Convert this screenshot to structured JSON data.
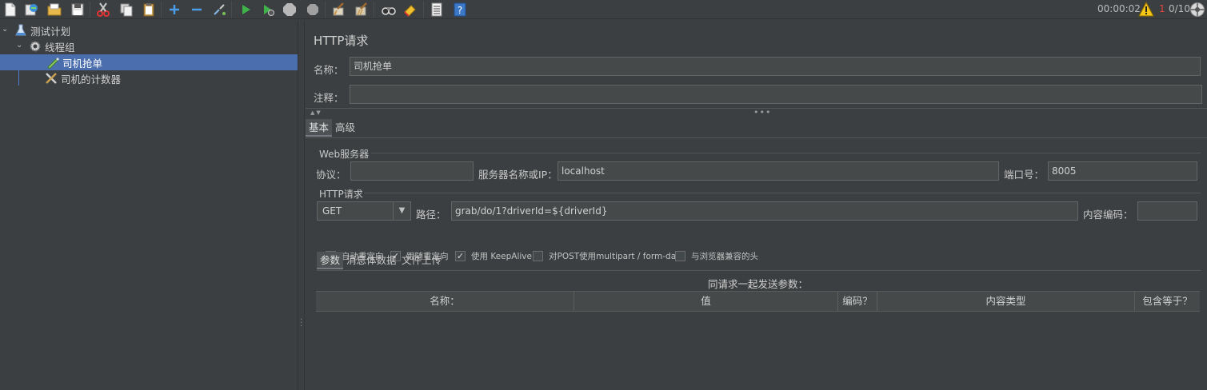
{
  "toolbar": {
    "icons": [
      "new-icon",
      "templates-icon",
      "open-icon",
      "save-icon",
      "cut-icon",
      "copy-icon",
      "paste-icon",
      "add-icon",
      "remove-icon",
      "toggle-icon",
      "start-icon",
      "start-no-pause-icon",
      "stop-icon",
      "shutdown-icon",
      "clear-icon",
      "clear-all-icon",
      "search-icon",
      "reset-search-icon",
      "function-helper-icon",
      "help-icon"
    ],
    "timer": "00:00:02",
    "error_count": "1",
    "threads": "0/10"
  },
  "tree": {
    "nodes": [
      {
        "label": "测试计划",
        "icon": "test-plan-icon"
      },
      {
        "label": "线程组",
        "icon": "thread-group-gear-icon"
      },
      {
        "label": "司机抢单",
        "icon": "http-sampler-pen-icon",
        "selected": true
      },
      {
        "label": "司机的计数器",
        "icon": "counter-tools-icon"
      }
    ]
  },
  "panel": {
    "title": "HTTP请求",
    "name_label": "名称：",
    "name_value": "司机抢单",
    "comment_label": "注释：",
    "comment_value": "",
    "tabs": [
      "基本",
      "高级"
    ],
    "web_server": {
      "group_label": "Web服务器",
      "protocol_label": "协议：",
      "protocol_value": "",
      "server_label": "服务器名称或IP：",
      "server_value": "localhost",
      "port_label": "端口号：",
      "port_value": "8005"
    },
    "http_request": {
      "group_label": "HTTP请求",
      "method": "GET",
      "path_label": "路径：",
      "path_value": "grab/do/1?driverId=${driverId}",
      "encoding_label": "内容编码：",
      "encoding_value": ""
    },
    "checkboxes": [
      {
        "label": "自动重定向",
        "checked": false
      },
      {
        "label": "跟随重定向",
        "checked": true
      },
      {
        "label": "使用 KeepAlive",
        "checked": true
      },
      {
        "label": "对POST使用multipart / form-data",
        "checked": false
      },
      {
        "label": "与浏览器兼容的头",
        "checked": false
      }
    ],
    "sub_tabs": [
      "参数",
      "消息体数据",
      "文件上传"
    ],
    "params": {
      "caption": "同请求一起发送参数：",
      "columns": [
        "名称：",
        "值",
        "编码？",
        "内容类型",
        "包含等于？"
      ]
    }
  },
  "colors": {
    "background": "#3c3f41",
    "selection": "#4b6eaf",
    "input_bg": "#45494a",
    "error_red": "#e2453e"
  }
}
